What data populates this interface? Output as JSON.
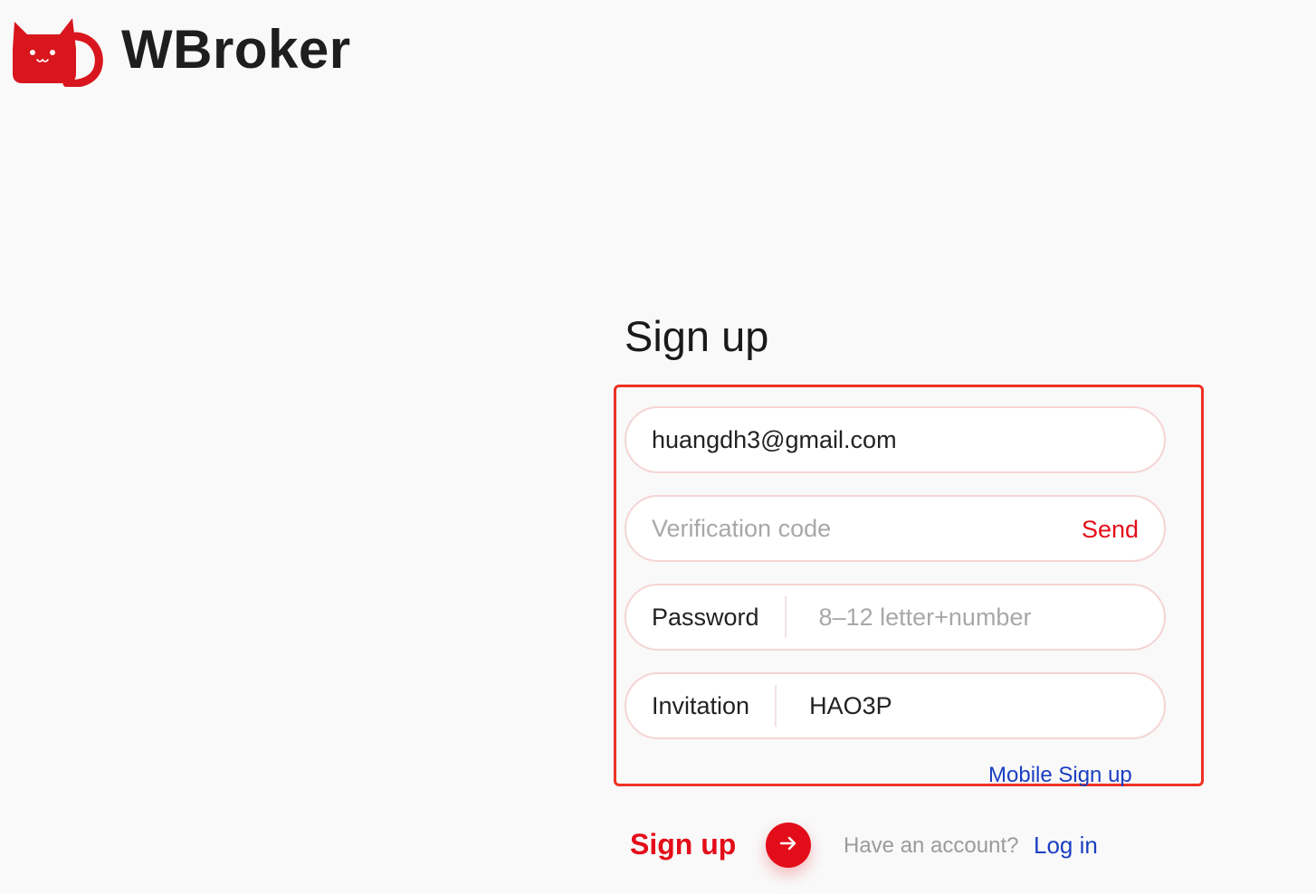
{
  "header": {
    "brand_name": "WBroker",
    "logo_icon": "red-cat-logo-icon"
  },
  "form": {
    "title": "Sign up",
    "email": {
      "value": "huangdh3@gmail.com",
      "placeholder": ""
    },
    "verification": {
      "value": "",
      "placeholder": "Verification code",
      "send_label": "Send"
    },
    "password": {
      "label": "Password",
      "value": "",
      "placeholder": "8–12 letter+number"
    },
    "invitation": {
      "label": "Invitation",
      "value": "HAO3P",
      "placeholder": ""
    },
    "mobile_signup_link": "Mobile Sign up"
  },
  "actions": {
    "signup_label": "Sign up",
    "arrow_icon": "arrow-right-icon",
    "have_account_text": "Have an account?",
    "login_link": "Log in"
  },
  "colors": {
    "brand_red": "#e30d19",
    "highlight_border": "#ee3124",
    "link_blue": "#1b3fc1",
    "field_border": "#f6d4d4",
    "background": "#f9f9f9"
  }
}
